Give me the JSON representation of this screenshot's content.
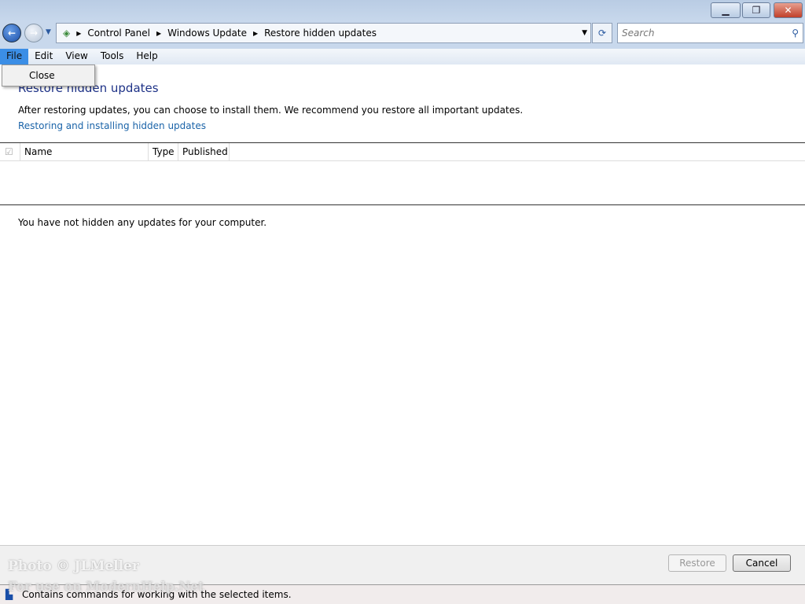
{
  "window": {
    "minimize": "▁",
    "maximize": "❐",
    "close": "✕"
  },
  "nav": {
    "back": "←",
    "forward": "→",
    "breadcrumb": [
      "Control Panel",
      "Windows Update",
      "Restore hidden updates"
    ],
    "search_placeholder": "Search"
  },
  "menu": {
    "items": [
      "File",
      "Edit",
      "View",
      "Tools",
      "Help"
    ],
    "dropdown": [
      "Close"
    ]
  },
  "main": {
    "title": "Restore hidden updates",
    "description": "After restoring updates, you can choose to install them. We recommend you restore all important updates.",
    "link": "Restoring and installing hidden updates",
    "columns": [
      "Name",
      "Type",
      "Published"
    ],
    "empty_message": "You have not hidden any updates for your computer."
  },
  "buttons": {
    "restore": "Restore",
    "cancel": "Cancel"
  },
  "status": "Contains commands for working with the selected items.",
  "watermark": [
    "Photo © JLMeller",
    "For use on ModernHelp.Net"
  ]
}
